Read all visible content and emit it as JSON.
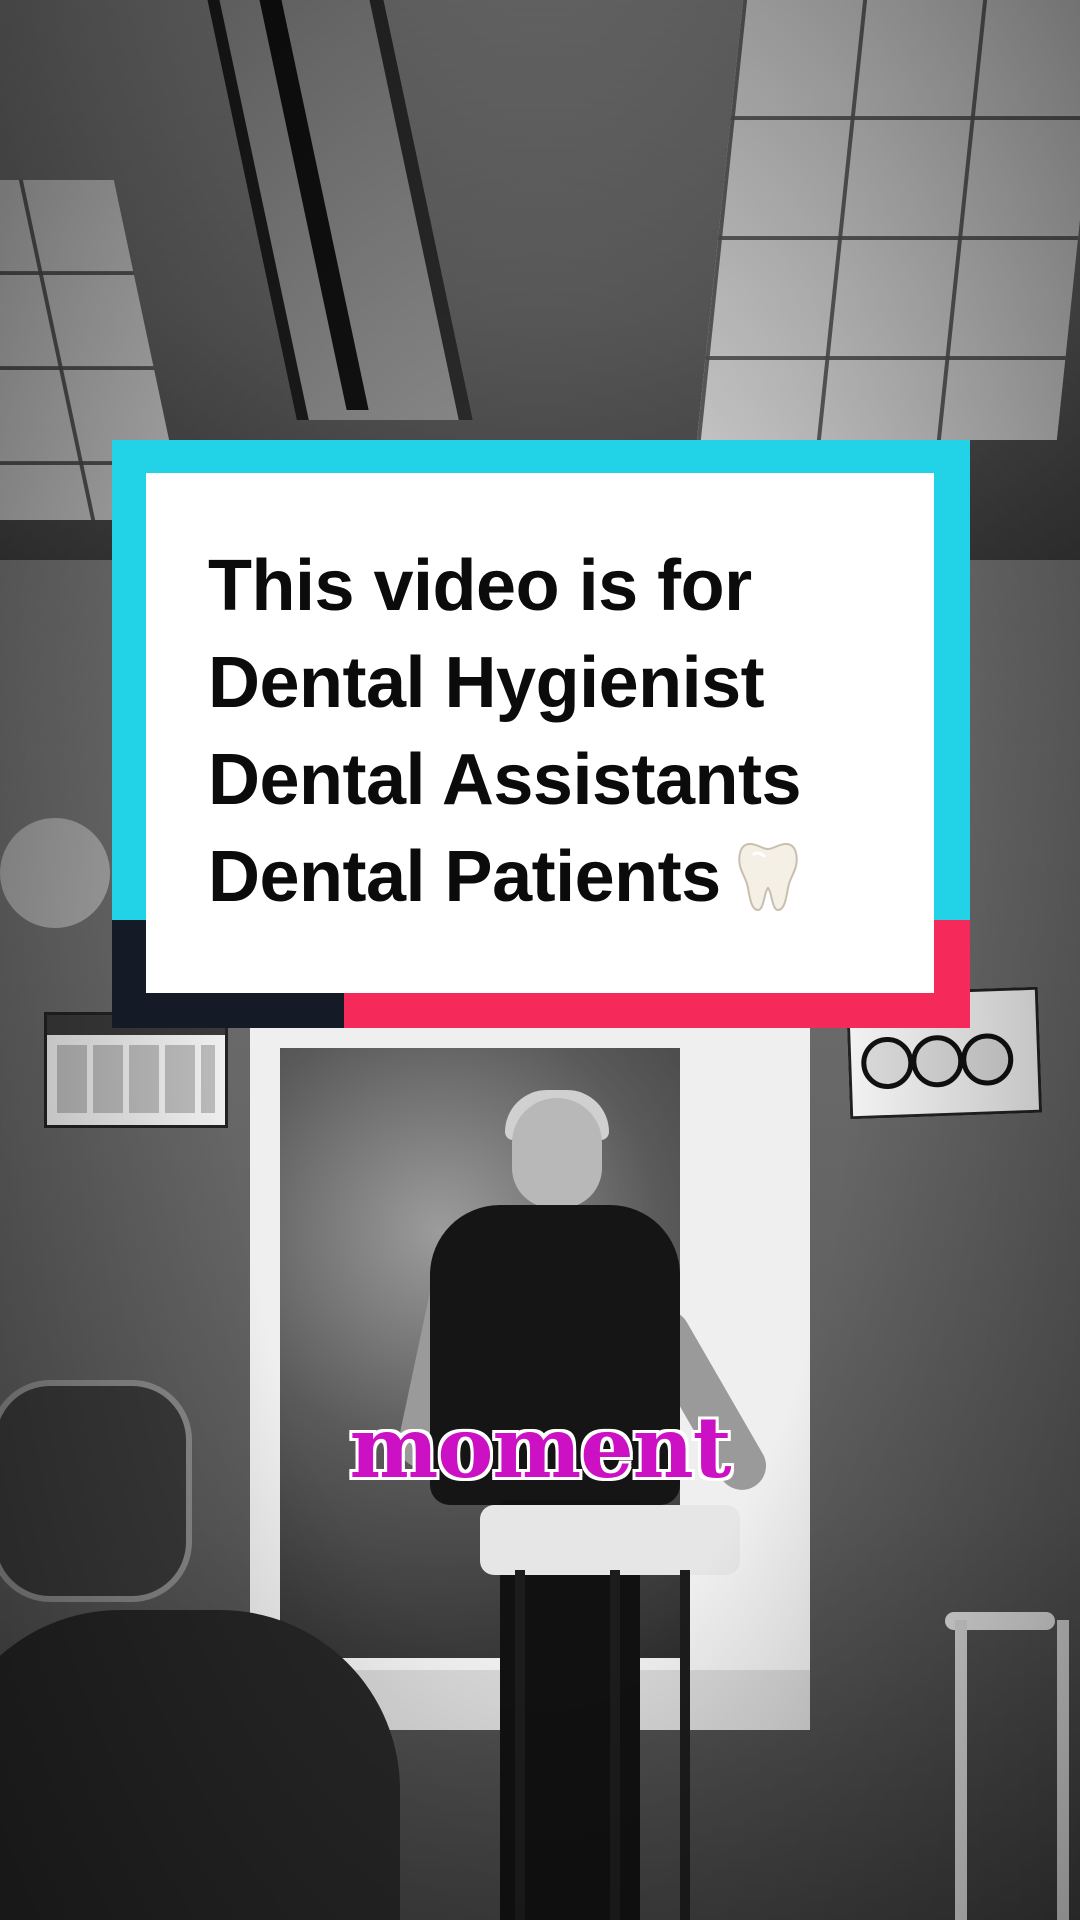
{
  "overlay_card": {
    "lines": [
      "This video is for",
      "Dental Hygienist",
      "Dental Assistants",
      "Dental Patients"
    ],
    "trailing_icon": "tooth-icon",
    "colors": {
      "frame_top": "#22d3e8",
      "frame_bottom_left": "#141a26",
      "frame_bottom_right": "#f5295a",
      "card_background": "#ffffff",
      "text": "#0b0b0b"
    }
  },
  "caption": {
    "text": "moment",
    "color": "#cc11c4",
    "outline_color": "#ffffff"
  },
  "background": {
    "style": "black-and-white photo of a dental operatory",
    "icons": [
      "dental-chair",
      "ceiling-light",
      "window",
      "wall-poster",
      "stool"
    ]
  }
}
